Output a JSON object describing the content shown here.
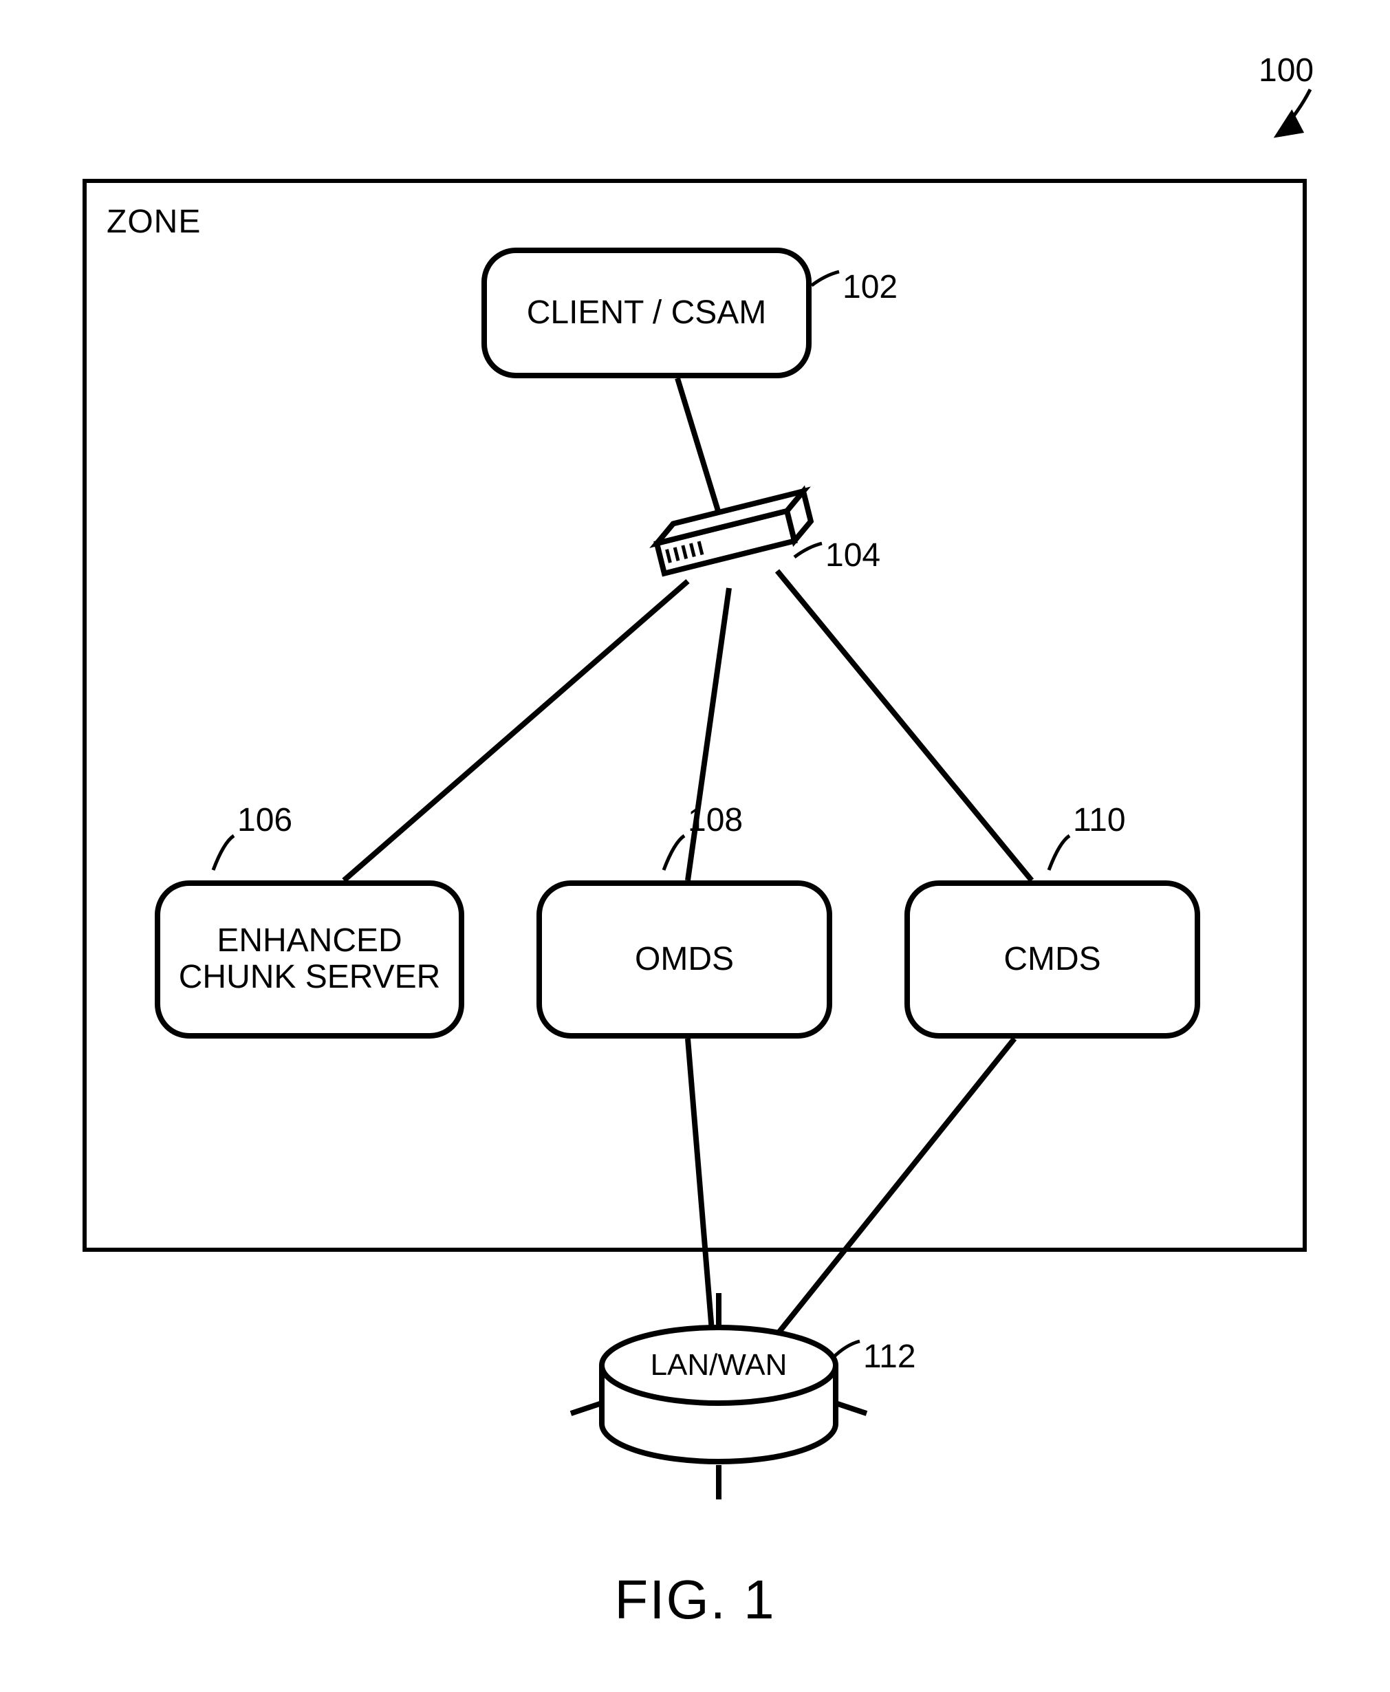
{
  "figure": {
    "caption": "FIG. 1",
    "system_ref": "100"
  },
  "zone": {
    "label": "ZONE"
  },
  "nodes": {
    "client": {
      "label": "CLIENT / CSAM",
      "ref": "102"
    },
    "switch": {
      "ref": "104"
    },
    "chunk": {
      "label": "ENHANCED\nCHUNK SERVER",
      "ref": "106"
    },
    "omds": {
      "label": "OMDS",
      "ref": "108"
    },
    "cmds": {
      "label": "CMDS",
      "ref": "110"
    },
    "lanwan": {
      "label": "LAN/WAN",
      "ref": "112"
    }
  }
}
